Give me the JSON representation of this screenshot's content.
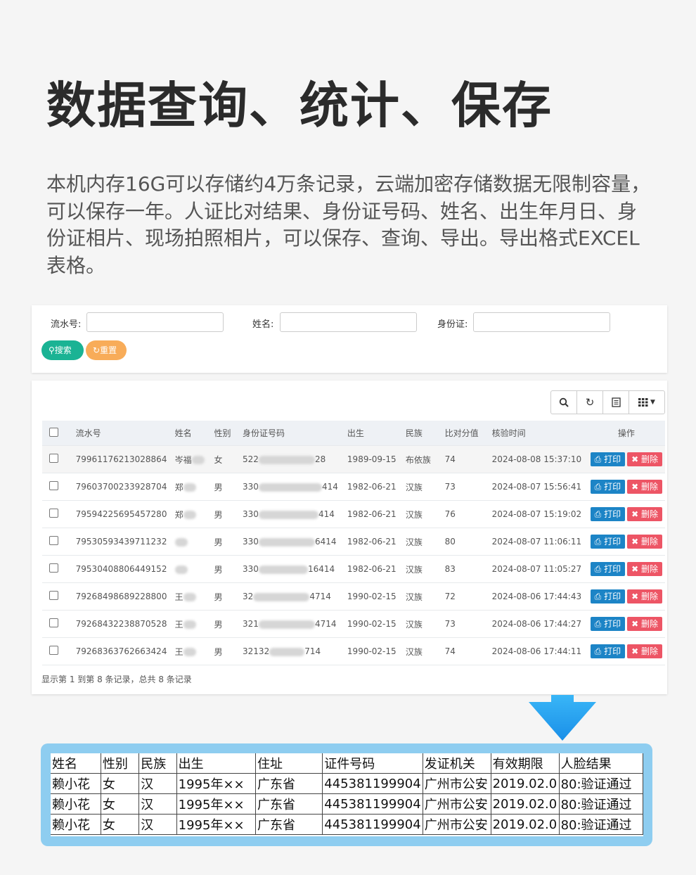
{
  "title": "数据查询、统计、保存",
  "description": "本机内存16G可以存储约4万条记录，云端加密存储数据无限制容量，可以保存一年。人证比对结果、身份证号码、姓名、出生年月日、身份证相片、现场拍照相片，可以保存、查询、导出。导出格式EXCEL表格。",
  "search": {
    "serial_label": "流水号:",
    "name_label": "姓名:",
    "id_label": "身份证:",
    "search_btn": "搜索",
    "reset_btn": "重置"
  },
  "table": {
    "headers": [
      "流水号",
      "姓名",
      "性别",
      "身份证号码",
      "出生",
      "民族",
      "比对分值",
      "核验时间",
      "操作"
    ],
    "print_label": "打印",
    "delete_label": "删除",
    "rows": [
      {
        "serial": "79961176213028864",
        "name": "岑福",
        "gender": "女",
        "id_prefix": "522",
        "id_suffix": "28",
        "birth": "1989-09-15",
        "ethnic": "布依族",
        "score": "74",
        "time": "2024-08-08 15:37:10"
      },
      {
        "serial": "79603700233928704",
        "name": "郑",
        "gender": "男",
        "id_prefix": "330",
        "id_suffix": "414",
        "birth": "1982-06-21",
        "ethnic": "汉族",
        "score": "73",
        "time": "2024-08-07 15:56:41"
      },
      {
        "serial": "79594225695457280",
        "name": "郑",
        "gender": "男",
        "id_prefix": "330",
        "id_suffix": "414",
        "birth": "1982-06-21",
        "ethnic": "汉族",
        "score": "76",
        "time": "2024-08-07 15:19:02"
      },
      {
        "serial": "79530593439711232",
        "name": "",
        "gender": "男",
        "id_prefix": "330",
        "id_suffix": "6414",
        "birth": "1982-06-21",
        "ethnic": "汉族",
        "score": "80",
        "time": "2024-08-07 11:06:11"
      },
      {
        "serial": "79530408806449152",
        "name": "",
        "gender": "男",
        "id_prefix": "330",
        "id_suffix": "16414",
        "birth": "1982-06-21",
        "ethnic": "汉族",
        "score": "83",
        "time": "2024-08-07 11:05:27"
      },
      {
        "serial": "79268498689228800",
        "name": "王",
        "gender": "男",
        "id_prefix": "32",
        "id_suffix": "4714",
        "birth": "1990-02-15",
        "ethnic": "汉族",
        "score": "72",
        "time": "2024-08-06 17:44:43"
      },
      {
        "serial": "79268432238870528",
        "name": "王",
        "gender": "男",
        "id_prefix": "321",
        "id_suffix": "4714",
        "birth": "1990-02-15",
        "ethnic": "汉族",
        "score": "73",
        "time": "2024-08-06 17:44:27"
      },
      {
        "serial": "79268363762663424",
        "name": "王",
        "gender": "男",
        "id_prefix": "32132",
        "id_suffix": "714",
        "birth": "1990-02-15",
        "ethnic": "汉族",
        "score": "74",
        "time": "2024-08-06 17:44:11"
      }
    ],
    "pager": "显示第 1 到第 8 条记录，总共 8 条记录"
  },
  "excel": {
    "headers": [
      "姓名",
      "性别",
      "民族",
      "出生",
      "住址",
      "证件号码",
      "发证机关",
      "有效期限",
      "人脸结果"
    ],
    "rows": [
      [
        "赖小花",
        "女",
        "汉",
        "1995年××",
        "广东省",
        "445381199904",
        "广州市公安",
        "2019.02.0",
        "80:验证通过"
      ],
      [
        "赖小花",
        "女",
        "汉",
        "1995年××",
        "广东省",
        "445381199904",
        "广州市公安",
        "2019.02.0",
        "80:验证通过"
      ],
      [
        "赖小花",
        "女",
        "汉",
        "1995年××",
        "广东省",
        "445381199904",
        "广州市公安",
        "2019.02.0",
        "80:验证通过"
      ]
    ]
  },
  "colors": {
    "search": "#1ab394",
    "reset": "#f8ac59",
    "print": "#1c84c6",
    "delete": "#ed5565",
    "arrow": "#1e9cf0",
    "excel_border": "#8ecdf0"
  },
  "icons": [
    "search-icon",
    "refresh-icon",
    "list-icon",
    "grid-icon",
    "caret-down-icon",
    "print-icon",
    "close-icon",
    "down-arrow-icon"
  ]
}
